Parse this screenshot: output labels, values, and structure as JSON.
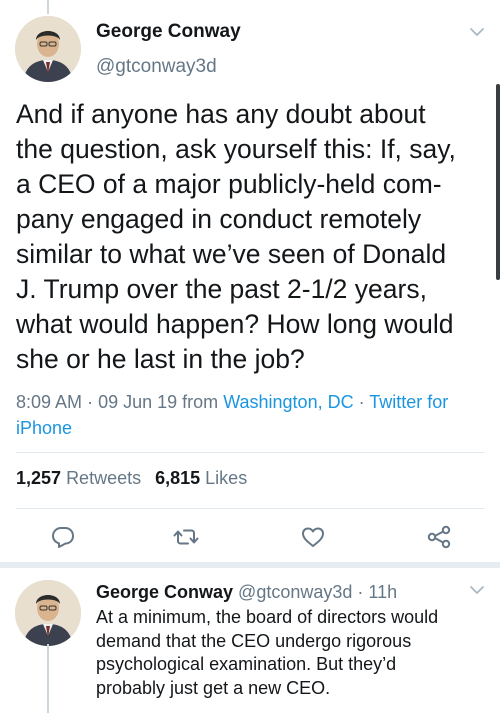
{
  "tweet": {
    "author_name": "George Conway",
    "author_handle": "@gtconway3d",
    "text": "And if anyone has any doubt about\nthe question, ask yourself this:  If, say,\na CEO of a major publicly-held com-\npany engaged in conduct remotely\nsimilar to what we’ve seen of Donald\nJ. Trump over the past 2-1/2 years,\nwhat would happen?  How long would\nshe or he last in the job?",
    "time": "8:09 AM",
    "date": "09 Jun 19",
    "from_label": "from",
    "location": "Washington, DC",
    "source": "Twitter for iPhone",
    "retweets_count": "1,257",
    "retweets_label": "Retweets",
    "likes_count": "6,815",
    "likes_label": "Likes"
  },
  "actions": {
    "reply_icon": "reply-icon",
    "retweet_icon": "retweet-icon",
    "like_icon": "heart-icon",
    "share_icon": "share-icon"
  },
  "reply": {
    "author_name": "George Conway",
    "author_handle": "@gtconway3d",
    "age": "11h",
    "text": "At a minimum, the board of directors would\ndemand that the CEO undergo rigorous\npsychological examination.  But they’d\nprobably just get a new CEO."
  },
  "colors": {
    "text": "#14171a",
    "secondary": "#657786",
    "link": "#1b95e0",
    "divider": "#e1e8ed"
  }
}
